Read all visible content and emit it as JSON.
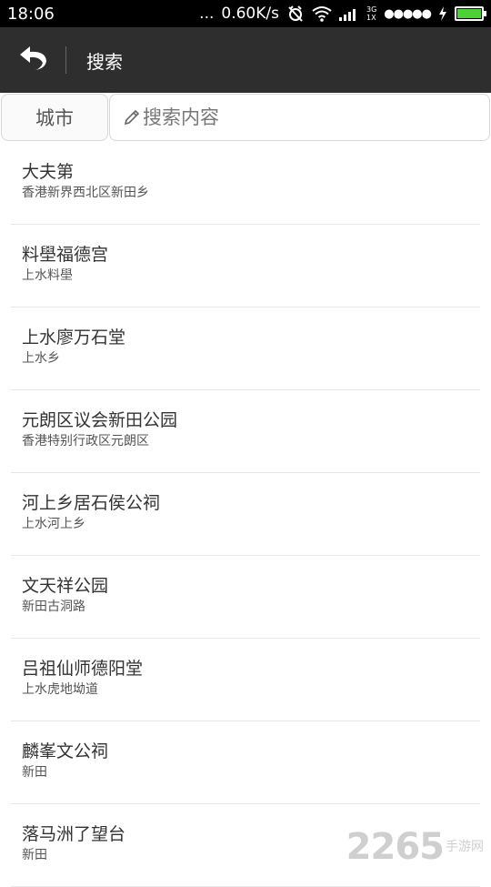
{
  "status_bar": {
    "time": "18:06",
    "dots": "...",
    "net_speed": "0.60K/s",
    "network_type_top": "3G",
    "network_type_bottom": "1X",
    "signal": "●●●●●",
    "battery_level": 1.0,
    "battery_color": "#4cd137"
  },
  "header": {
    "title": "搜索",
    "back_icon": "back-arrow-icon",
    "bg_color": "#2e2e2e"
  },
  "search": {
    "city_label": "城市",
    "placeholder": "搜索内容",
    "value": ""
  },
  "results": [
    {
      "title": "大夫第",
      "subtitle": "香港新界西北区新田乡"
    },
    {
      "title": "料壆福德宫",
      "subtitle": "上水料壆"
    },
    {
      "title": "上水廖万石堂",
      "subtitle": "上水乡"
    },
    {
      "title": "元朗区议会新田公园",
      "subtitle": "香港特别行政区元朗区"
    },
    {
      "title": "河上乡居石侯公祠",
      "subtitle": "上水河上乡"
    },
    {
      "title": "文天祥公园",
      "subtitle": "新田古洞路"
    },
    {
      "title": "吕祖仙师德阳堂",
      "subtitle": "上水虎地坳道"
    },
    {
      "title": "麟峯文公祠",
      "subtitle": "新田"
    },
    {
      "title": "落马洲了望台",
      "subtitle": "新田"
    }
  ],
  "watermark": {
    "number": "2265",
    "text": "手游网"
  }
}
